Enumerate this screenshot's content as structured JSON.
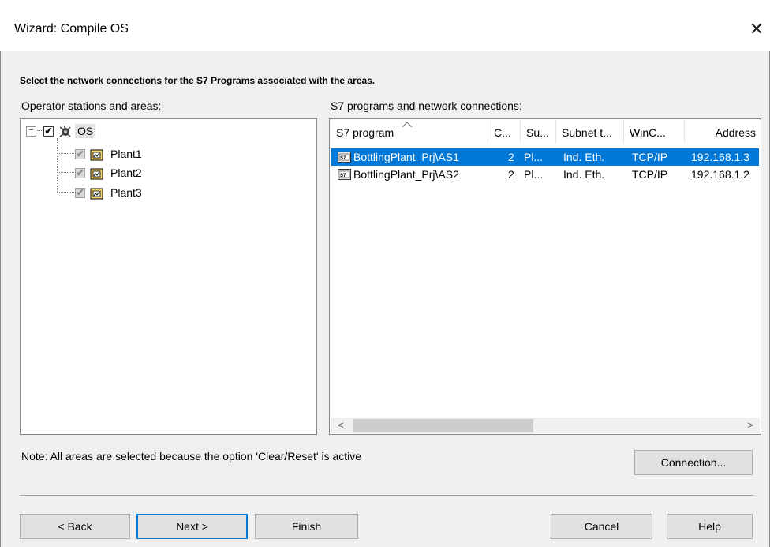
{
  "window": {
    "title": "Wizard: Compile OS",
    "close_icon": "close-icon"
  },
  "instruction": "Select the network connections for the S7 Programs associated with the areas.",
  "left_panel": {
    "label": "Operator stations and areas:",
    "root": {
      "label": "OS",
      "expander": "−",
      "checked": "✔"
    },
    "areas": [
      {
        "label": "Plant1",
        "checked": "✔"
      },
      {
        "label": "Plant2",
        "checked": "✔"
      },
      {
        "label": "Plant3",
        "checked": "✔"
      }
    ]
  },
  "right_panel": {
    "label": "S7 programs and network connections:",
    "columns": [
      "S7 program",
      "C...",
      "Su...",
      "Subnet t...",
      "WinC...",
      "Address"
    ],
    "rows": [
      {
        "program": "BottlingPlant_Prj\\AS1",
        "c": "2",
        "su": "Pl...",
        "subnet": "Ind. Eth.",
        "winc": "TCP/IP",
        "address": "192.168.1.3",
        "selected": true
      },
      {
        "program": "BottlingPlant_Prj\\AS2",
        "c": "2",
        "su": "Pl...",
        "subnet": "Ind. Eth.",
        "winc": "TCP/IP",
        "address": "192.168.1.2",
        "selected": false
      }
    ],
    "scroll_left": "<",
    "scroll_right": ">"
  },
  "note": "Note: All areas are selected because the option 'Clear/Reset' is active",
  "buttons": {
    "connection": "Connection...",
    "back": "< Back",
    "next": "Next >",
    "finish": "Finish",
    "cancel": "Cancel",
    "help": "Help"
  },
  "colors": {
    "selection": "#0078d7",
    "default_button_border": "#0078d7"
  }
}
